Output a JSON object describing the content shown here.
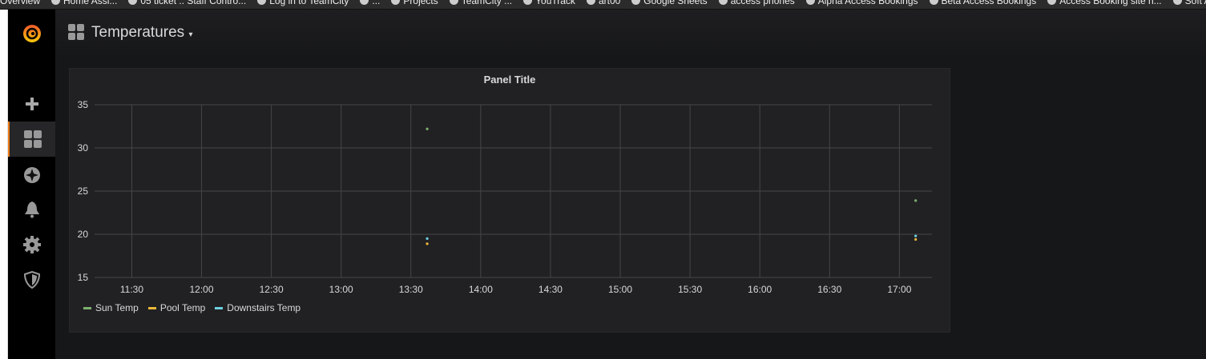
{
  "bookmarks": [
    "Overview",
    "Home Assi...",
    "05 ticket :: Staff Contro...",
    "Log in to TeamCity",
    "...",
    "Projects",
    "TeamCity ...",
    "YouTrack",
    "art00",
    "Google Sheets",
    "access phones",
    "Alpha Access Bookings",
    "Beta Access Bookings",
    "Access Booking site n...",
    "Soft Admi..."
  ],
  "dashboard": {
    "title": "Temperatures"
  },
  "sidebar": [
    "plus-icon",
    "dashboards-icon",
    "explore-icon",
    "alerting-icon",
    "configuration-icon",
    "shield-icon"
  ],
  "chart_data": {
    "type": "scatter",
    "title": "Panel Title",
    "xlabel": "",
    "ylabel": "",
    "ylim": [
      15,
      35
    ],
    "yticks": [
      15,
      20,
      25,
      30,
      35
    ],
    "xlim_minutes": [
      674,
      1034
    ],
    "xticks": [
      "11:30",
      "12:00",
      "12:30",
      "13:00",
      "13:30",
      "14:00",
      "14:30",
      "15:00",
      "15:30",
      "16:00",
      "16:30",
      "17:00"
    ],
    "grid": true,
    "legend": "bottom-left",
    "series": [
      {
        "name": "Sun Temp",
        "color": "#7eb26d",
        "points": [
          [
            "13:37",
            32.2
          ],
          [
            "17:07",
            23.9
          ]
        ]
      },
      {
        "name": "Pool Temp",
        "color": "#eab839",
        "points": [
          [
            "13:37",
            18.9
          ],
          [
            "17:07",
            19.4
          ]
        ]
      },
      {
        "name": "Downstairs Temp",
        "color": "#6ed0e0",
        "points": [
          [
            "13:37",
            19.5
          ],
          [
            "17:07",
            19.8
          ]
        ]
      }
    ]
  }
}
